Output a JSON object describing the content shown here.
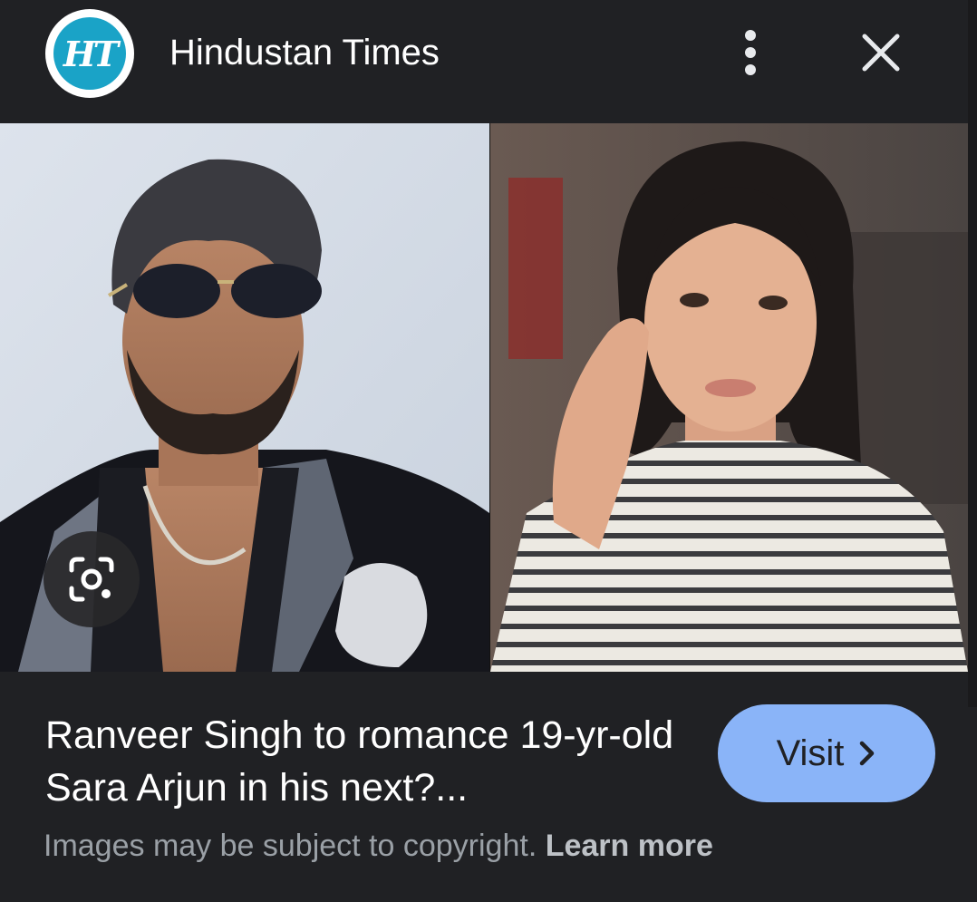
{
  "header": {
    "logo_text": "HT",
    "source_name": "Hindustan Times",
    "more_icon": "more-vert-icon",
    "close_icon": "close-icon"
  },
  "images": {
    "lens_icon": "google-lens-icon",
    "left_subject": "man-in-sunglasses-photo",
    "right_subject": "girl-in-striped-top-photo"
  },
  "result": {
    "title": "Ranveer Singh to romance 19-yr-old Sara Arjun in his next?...",
    "visit_label": "Visit",
    "visit_icon": "chevron-right-icon"
  },
  "footer": {
    "copyright_text": "Images may be subject to copyright.",
    "learn_more_label": "Learn more"
  },
  "colors": {
    "background": "#202124",
    "accent_button": "#8ab4f8",
    "logo_teal": "#1aa3c7"
  }
}
